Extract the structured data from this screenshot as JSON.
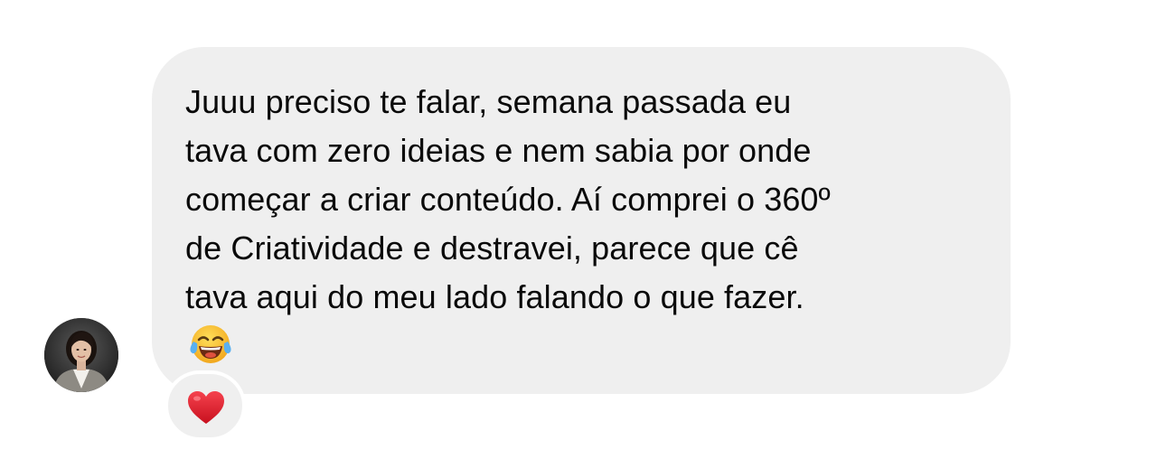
{
  "conversation": {
    "message": {
      "lines": [
        "Juuu preciso te falar, semana passada eu",
        "tava com zero ideias e nem sabia por onde",
        "começar a criar conteúdo. Aí comprei o 360º",
        "de Criatividade e destravei, parece que cê",
        "tava aqui do meu lado falando o que fazer."
      ],
      "emoji": "face-with-tears-of-joy-icon",
      "reaction": "red-heart-icon"
    },
    "sender_avatar": "avatar"
  },
  "colors": {
    "bubble": "#efefef",
    "text": "#0a0a0a",
    "background": "#ffffff",
    "heart": "#e0202e",
    "emoji_face": "#f7c531"
  }
}
